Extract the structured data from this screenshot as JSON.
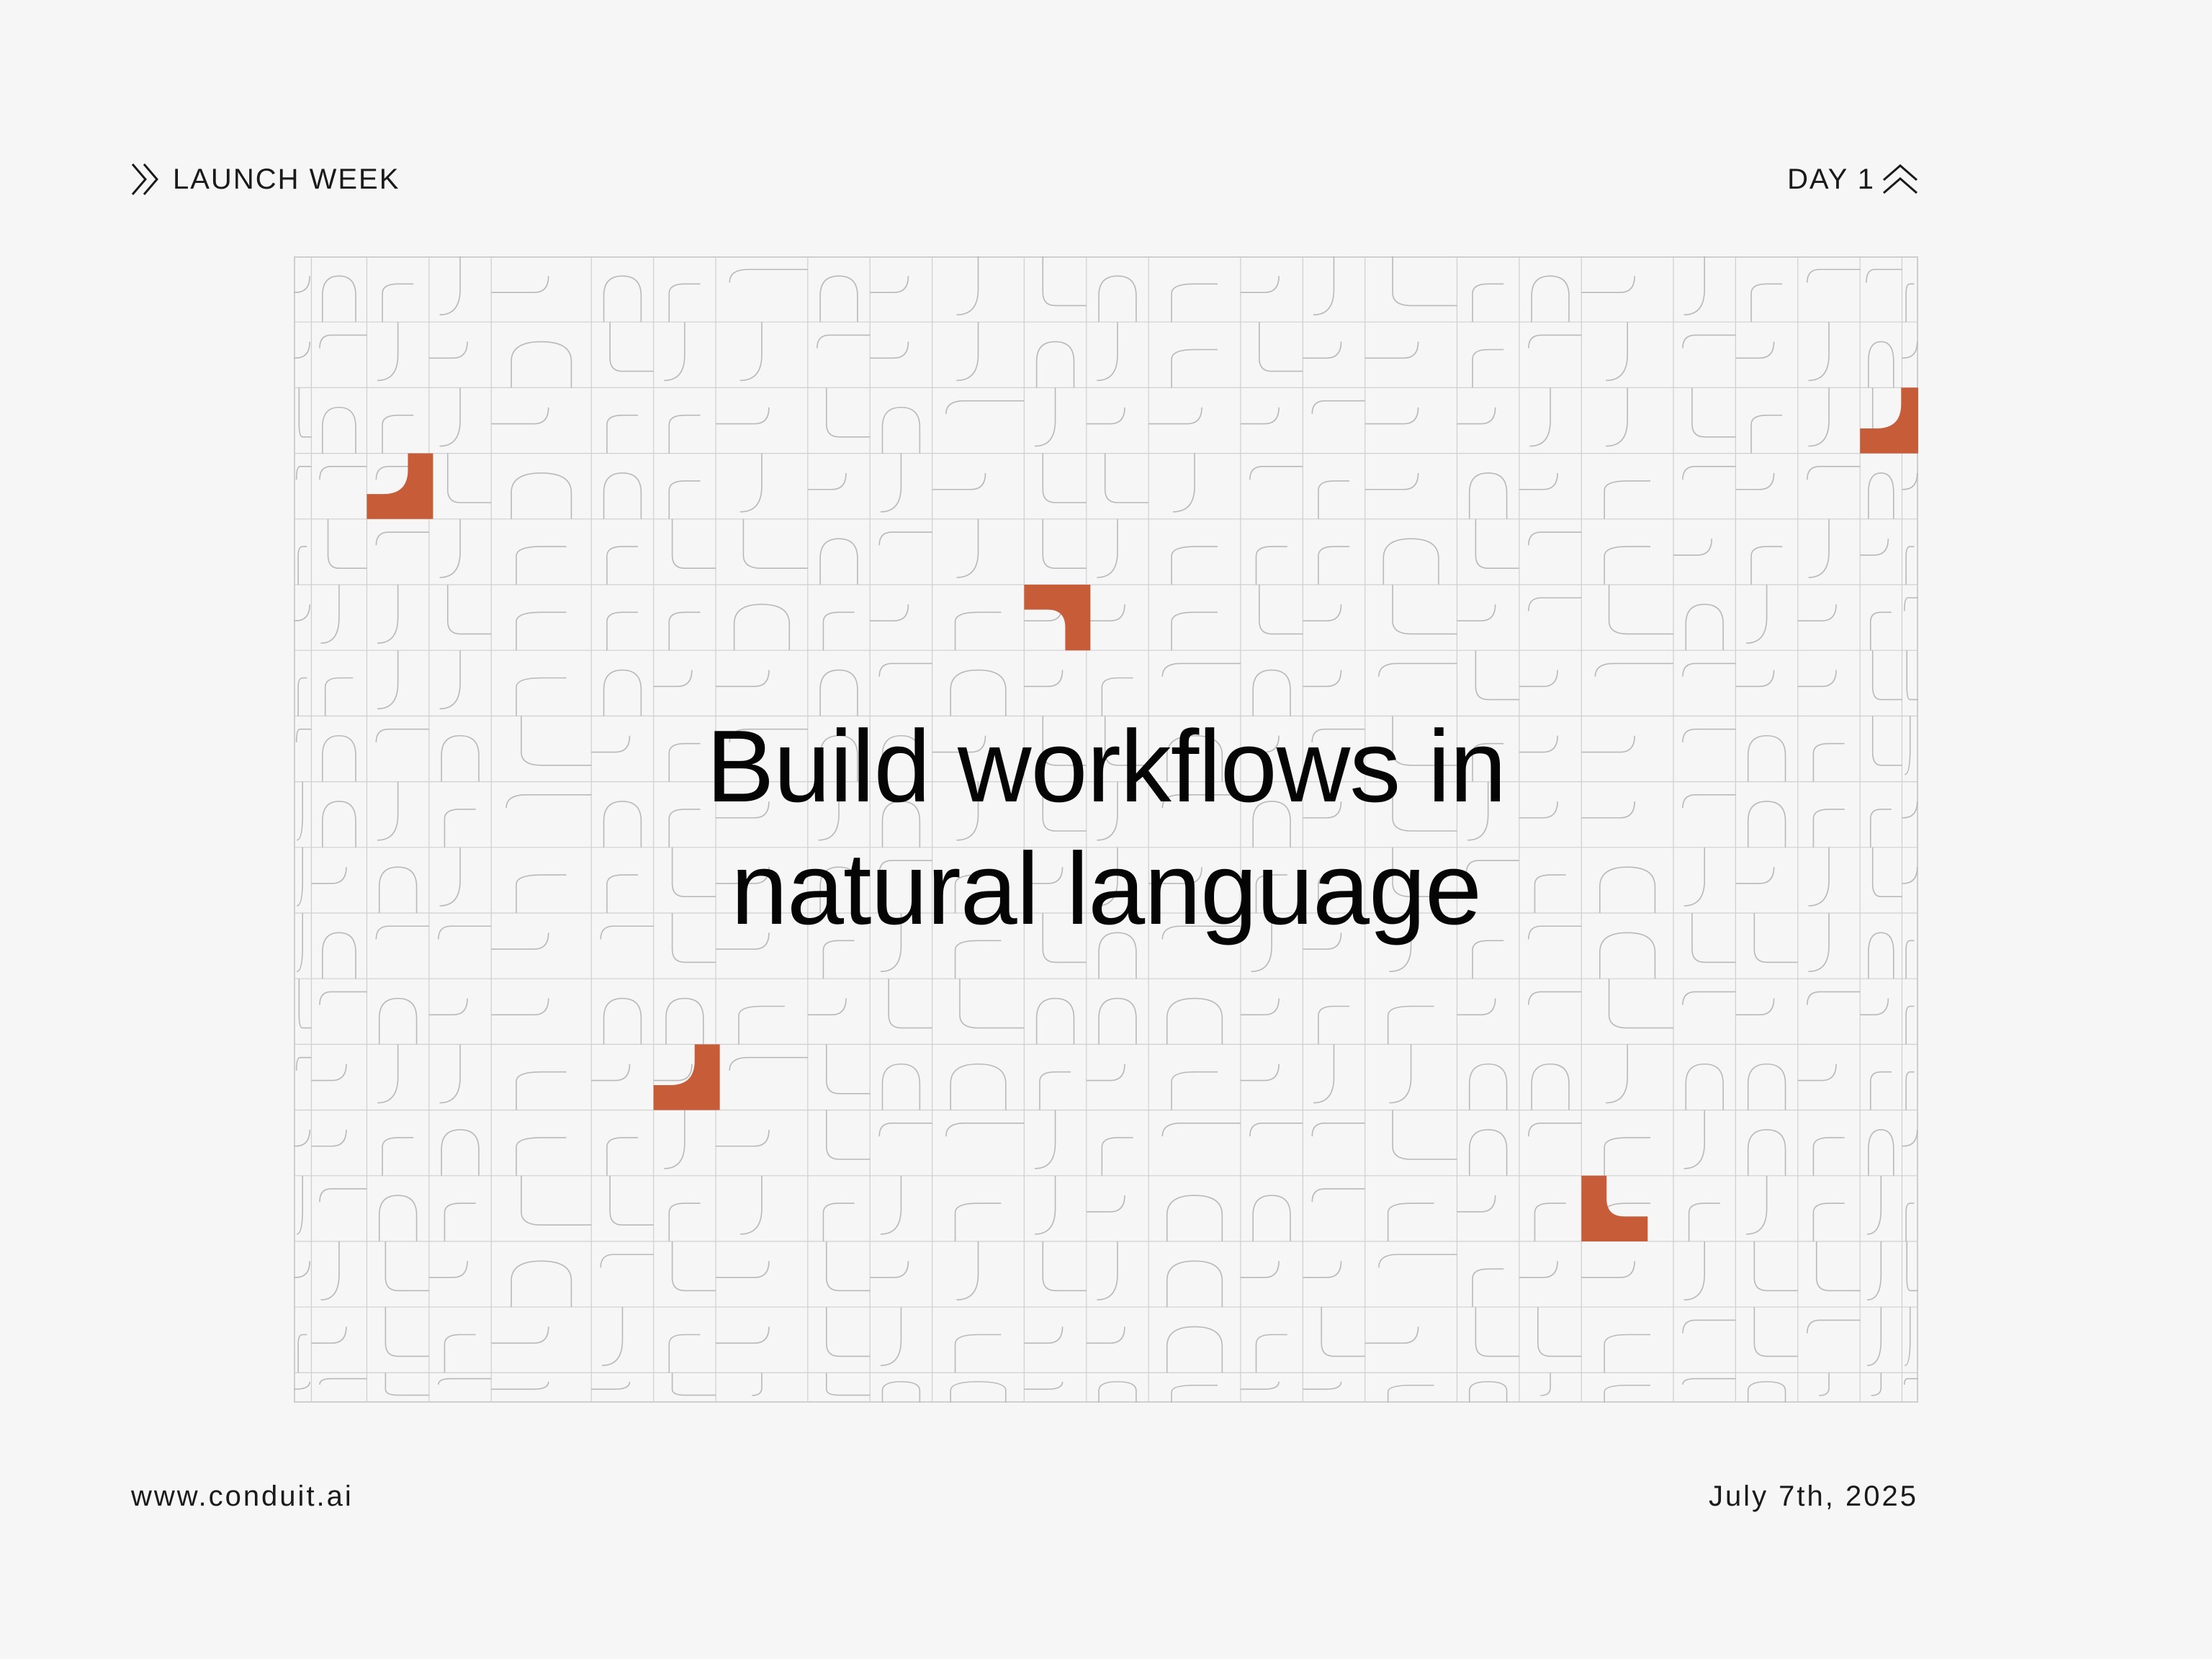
{
  "header": {
    "left_label": "LAUNCH WEEK",
    "left_icon": "double-chevron-right-icon",
    "right_label": "DAY 1",
    "right_icon": "double-chevron-up-icon"
  },
  "headline": {
    "line1": "Build workflows in",
    "line2": "natural language"
  },
  "footer": {
    "website": "www.conduit.ai",
    "date": "July 7th, 2025"
  },
  "colors": {
    "background": "#f6f6f6",
    "grid_line": "#cfcfcf",
    "pattern_stroke": "#b9b9b9",
    "accent": "#c75d38",
    "text": "#1a1a1a"
  }
}
